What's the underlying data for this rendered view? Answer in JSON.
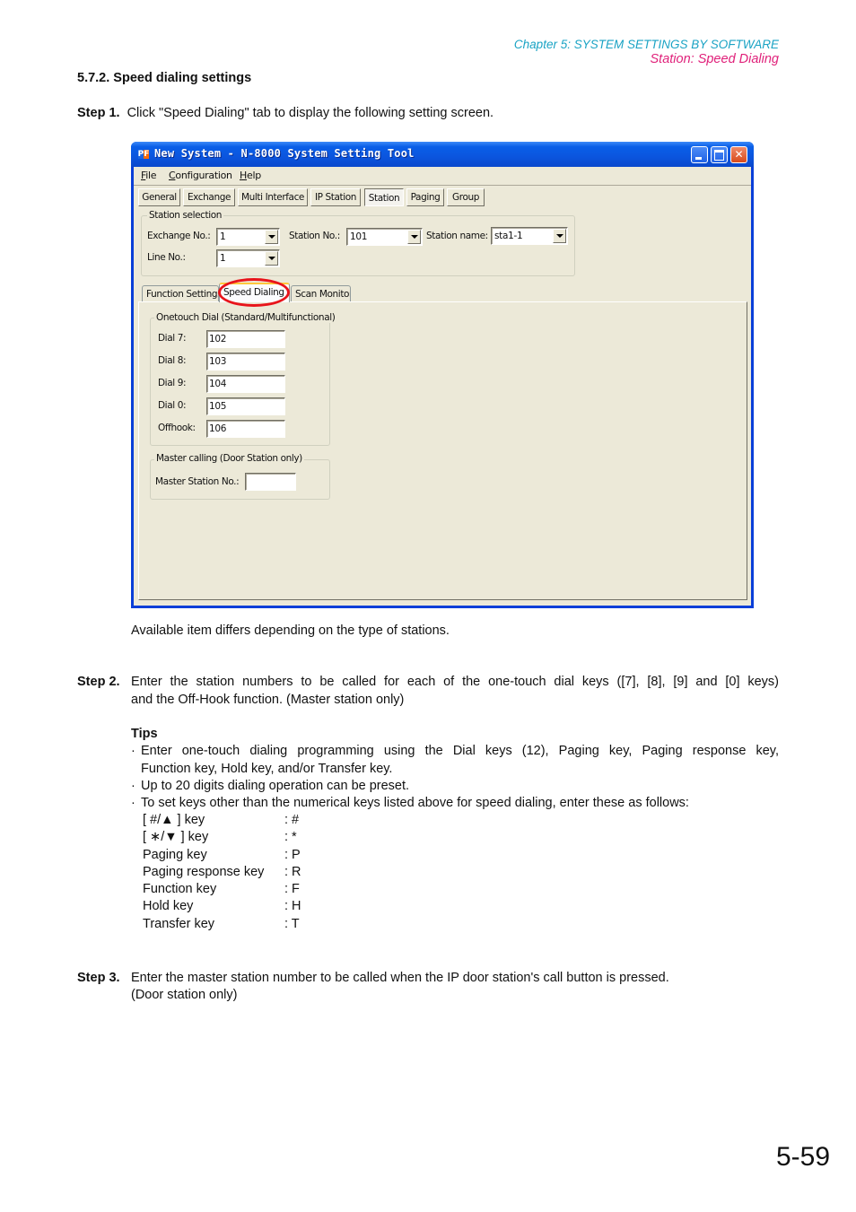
{
  "header": {
    "chapter": "Chapter 5:  SYSTEM SETTINGS BY SOFTWARE",
    "section": "Station: Speed Dialing"
  },
  "section_title": "5.7.2. Speed dialing settings",
  "steps": [
    {
      "label": "Step 1.",
      "text": "Click \"Speed Dialing\" tab to display the following setting screen."
    },
    {
      "label": "Step 2.",
      "lines": [
        "Enter the station numbers to be called for each of the one-touch dial keys ([7], [8], [9] and [0] keys)",
        "and the Off-Hook function. (Master station only)"
      ]
    },
    {
      "label": "Step 3.",
      "lines": [
        "Enter the master station number to be called when the IP door station's call button is pressed.",
        "(Door station only)"
      ]
    }
  ],
  "caption": "Available item differs depending on the type of stations.",
  "window": {
    "icon": "app-icon",
    "icon_text_1": "P",
    "icon_text_2": "F",
    "title": "New System - N-8000 System Setting Tool",
    "menu": [
      {
        "u": "F",
        "rest": "ile"
      },
      {
        "u": "C",
        "rest": "onfiguration"
      },
      {
        "u": "H",
        "rest": "elp"
      }
    ],
    "toolbar_buttons": [
      "General",
      "Exchange",
      "Multi Interface",
      "IP Station",
      "Station",
      "Paging",
      "Group"
    ],
    "active_toolbar": "Station",
    "station_selection": {
      "title": "Station selection",
      "exchange_label": "Exchange No.:",
      "exchange_value": "1",
      "station_no_label": "Station No.:",
      "station_no_value": "101",
      "station_name_label": "Station name:",
      "station_name_value": "sta1-1",
      "line_label": "Line No.:",
      "line_value": "1"
    },
    "tabs": [
      "Function Settings",
      "Speed Dialing",
      "Scan Monitor"
    ],
    "active_tab": "Speed Dialing",
    "onetouch": {
      "title": "Onetouch Dial (Standard/Multifunctional)",
      "fields": [
        {
          "label": "Dial 7:",
          "value": "102"
        },
        {
          "label": "Dial 8:",
          "value": "103"
        },
        {
          "label": "Dial 9:",
          "value": "104"
        },
        {
          "label": "Dial 0:",
          "value": "105"
        },
        {
          "label": "Offhook:",
          "value": "106"
        }
      ]
    },
    "master_calling": {
      "title": "Master calling (Door Station only)",
      "label": "Master Station No.:",
      "value": ""
    }
  },
  "tips": {
    "title": "Tips",
    "bullets": [
      [
        "Enter one-touch dialing programming using the Dial keys (12), Paging key, Paging response key,",
        "Function key, Hold key, and/or Transfer key."
      ],
      [
        "Up to 20 digits dialing operation can be preset."
      ],
      [
        "To set keys other than the numerical keys listed above for speed dialing, enter these as follows:"
      ]
    ],
    "key_map": [
      {
        "key": "[ #/▲ ] key",
        "value": ": #"
      },
      {
        "key": "[ ∗/▼ ] key",
        "value": ": *"
      },
      {
        "key": "Paging key",
        "value": ": P"
      },
      {
        "key": "Paging response key",
        "value": ": R"
      },
      {
        "key": "Function key",
        "value": ": F"
      },
      {
        "key": "Hold key",
        "value": ": H"
      },
      {
        "key": "Transfer key",
        "value": ": T"
      }
    ]
  },
  "page_number": "5-59",
  "colors": {
    "chapter": "#1aa3c4",
    "section": "#e0217a",
    "highlight": "#e8141b",
    "titlebar": "#0a55de",
    "window_bg": "#ece9d8"
  }
}
